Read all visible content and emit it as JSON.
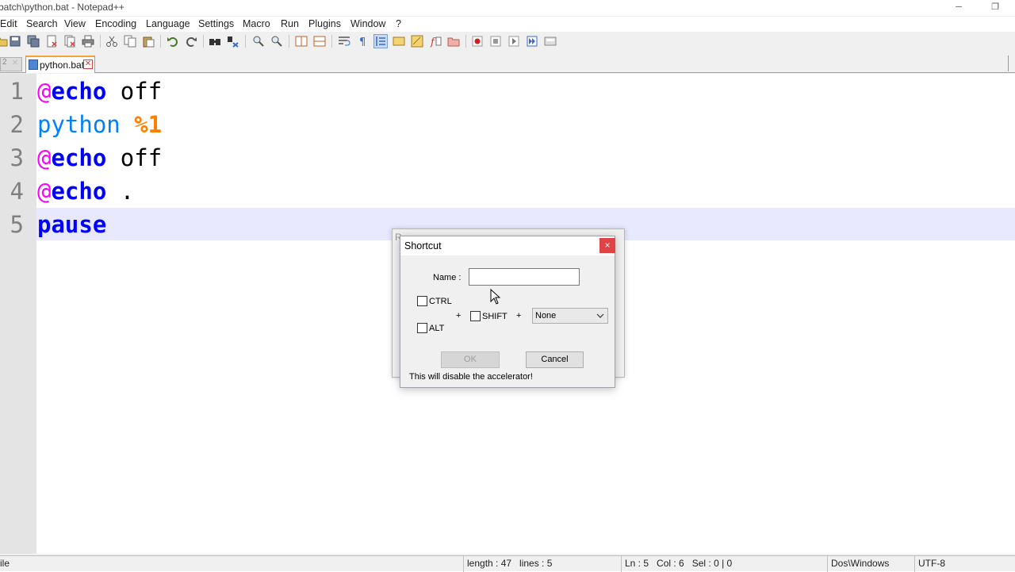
{
  "window": {
    "title": "batch\\python.bat - Notepad++",
    "minimize_glyph": "─",
    "restore_glyph": "❐"
  },
  "menu": [
    "Edit",
    "Search",
    "View",
    "Encoding",
    "Language",
    "Settings",
    "Macro",
    "Run",
    "Plugins",
    "Window",
    "?"
  ],
  "tabs": {
    "prev_label": "2",
    "active_label": "python.bat",
    "close_glyph": "✕"
  },
  "editor": {
    "line_numbers": [
      "1",
      "2",
      "3",
      "4",
      "5"
    ],
    "lines": [
      {
        "a": "@",
        "b": "echo",
        "c": " off"
      },
      {
        "a": "python",
        "b": " %1"
      },
      {
        "a": "@",
        "b": "echo",
        "c": " off"
      },
      {
        "a": "@",
        "b": "echo",
        "c": " ."
      },
      {
        "a": "pause"
      }
    ]
  },
  "background_dialog": {
    "title_fragment": "R"
  },
  "dialog": {
    "title": "Shortcut",
    "close_glyph": "×",
    "name_label": "Name :",
    "name_value": "",
    "ctrl_label": "CTRL",
    "alt_label": "ALT",
    "shift_label": "SHIFT",
    "plus_1": "+",
    "plus_2": "+",
    "key_selected": "None",
    "ok_label": "OK",
    "cancel_label": "Cancel",
    "warning": "This will disable the accelerator!"
  },
  "status": {
    "file_type": "ile",
    "length": "length : 47",
    "lines": "lines : 5",
    "ln": "Ln : 5",
    "col": "Col : 6",
    "sel": "Sel : 0 | 0",
    "eol": "Dos\\Windows",
    "encoding": "UTF-8"
  },
  "colors": {
    "keyword": "#0000ff",
    "at_sign": "#ff00ff",
    "external": "#0080ff",
    "variable": "#ff8000",
    "current_line": "#e8e8ff",
    "close_red": "#e04343"
  }
}
